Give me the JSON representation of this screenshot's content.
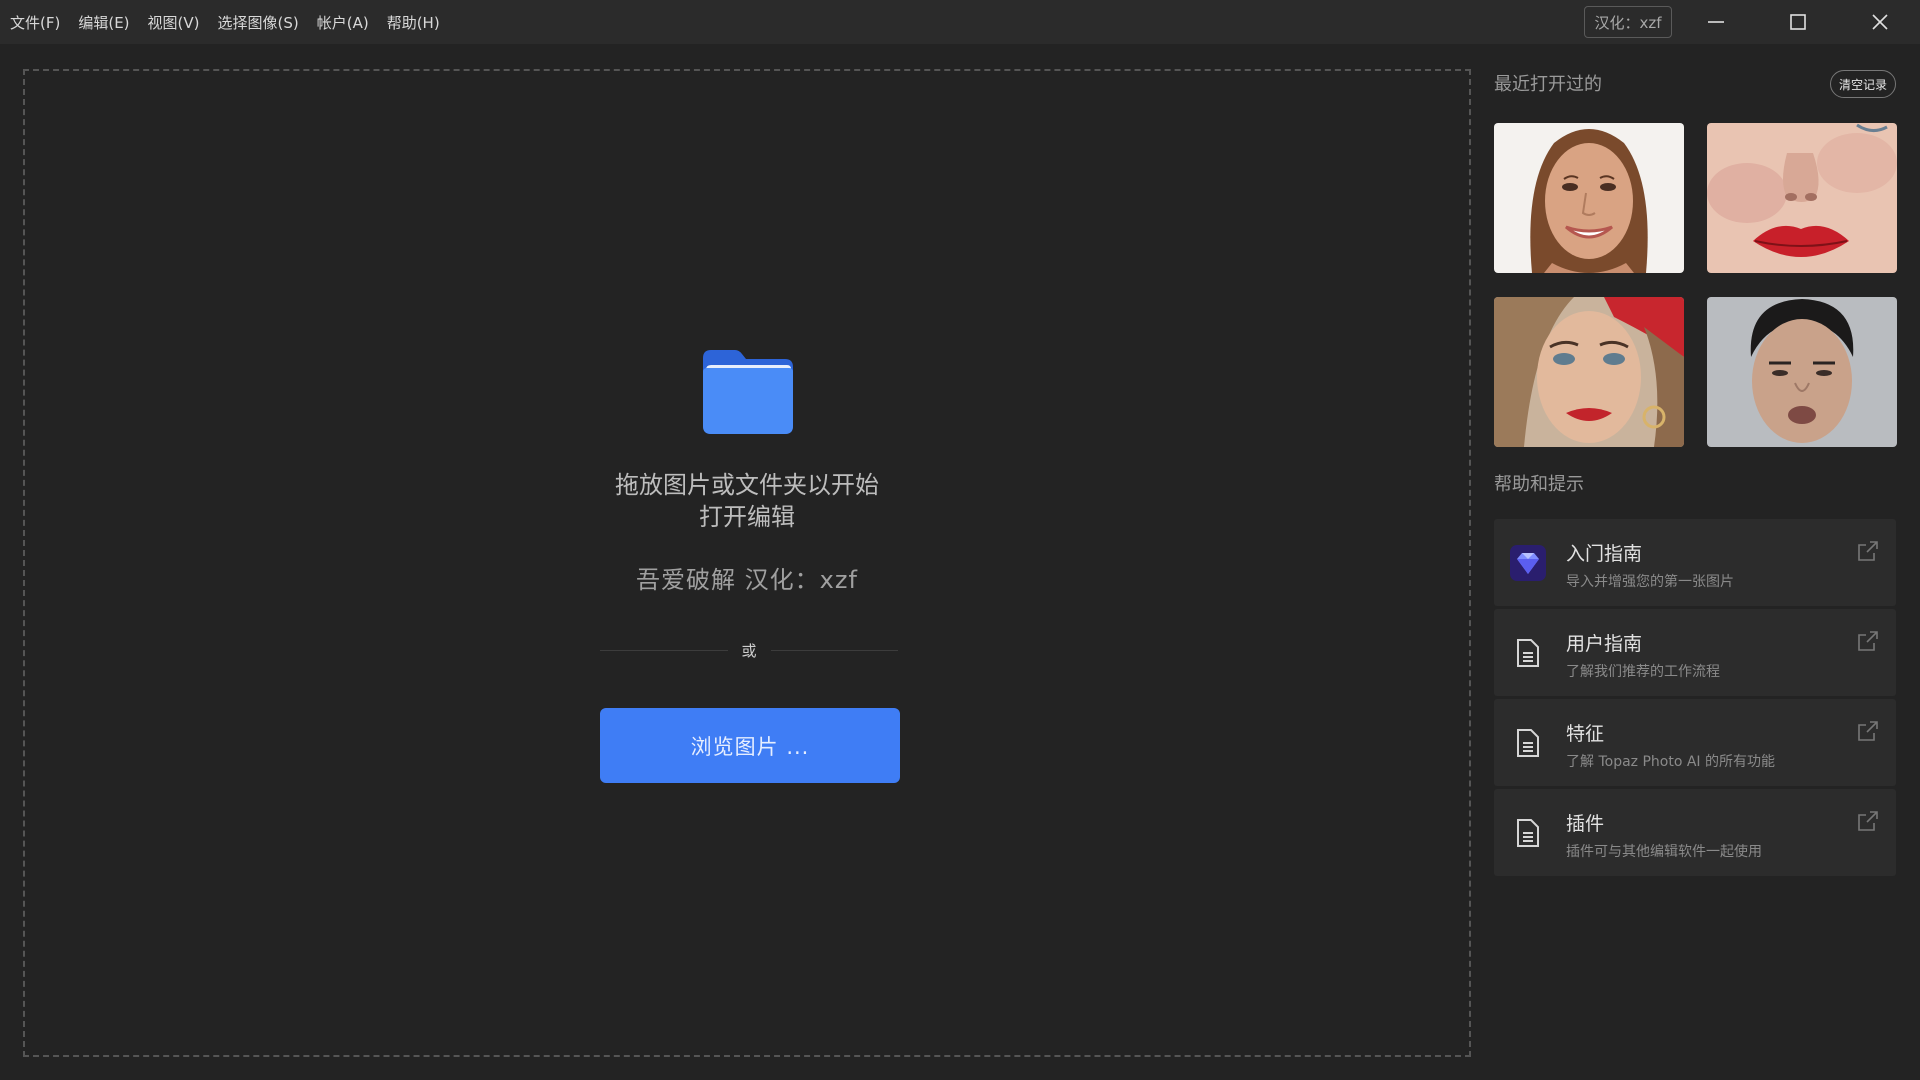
{
  "menu": [
    {
      "id": "file",
      "label": "文件(F)"
    },
    {
      "id": "edit",
      "label": "编辑(E)"
    },
    {
      "id": "view",
      "label": "视图(V)"
    },
    {
      "id": "select-image",
      "label": "选择图像(S)"
    },
    {
      "id": "account",
      "label": "帐户(A)"
    },
    {
      "id": "help",
      "label": "帮助(H)"
    }
  ],
  "titlebar": {
    "credit_badge": "汉化：xzf"
  },
  "dropzone": {
    "line1": "拖放图片或文件夹以开始",
    "line2": "打开编辑",
    "credit": "吾爱破解   汉化：xzf",
    "or_text": "或",
    "browse_label": "浏览图片 ..."
  },
  "recent": {
    "title": "最近打开过的",
    "clear_label": "清空记录",
    "thumbnails": [
      "smiling-woman-photo",
      "red-lips-closeup-photo",
      "woman-red-beret-photo",
      "man-portrait-photo"
    ]
  },
  "help": {
    "title": "帮助和提示",
    "cards": [
      {
        "title": "入门指南",
        "subtitle": "导入并增强您的第一张图片",
        "icon": "gem-icon"
      },
      {
        "title": "用户指南",
        "subtitle": "了解我们推荐的工作流程",
        "icon": "document-icon"
      },
      {
        "title": "特征",
        "subtitle": "了解 Topaz Photo AI 的所有功能",
        "icon": "document-icon"
      },
      {
        "title": "插件",
        "subtitle": "插件可与其他编辑软件一起使用",
        "icon": "document-icon"
      }
    ]
  },
  "colors": {
    "accent": "#3f7df5",
    "background": "#232323",
    "card": "#2c2c2c"
  }
}
